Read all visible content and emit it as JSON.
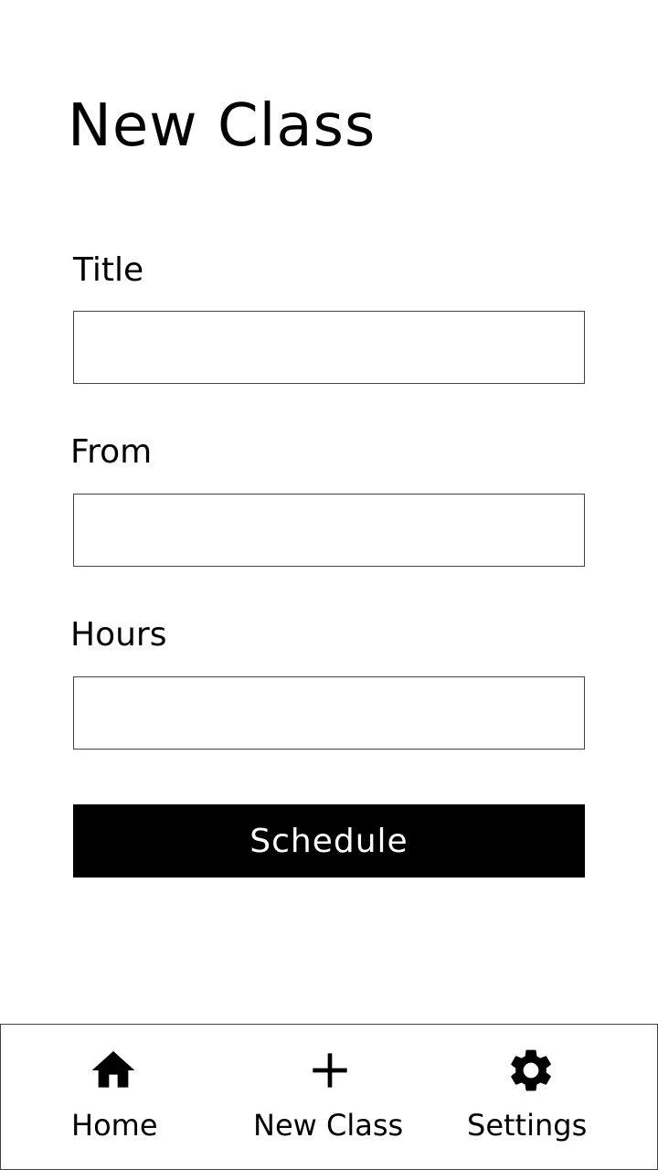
{
  "header": {
    "title": "New Class"
  },
  "form": {
    "title_label": "Title",
    "title_value": "",
    "from_label": "From",
    "from_value": "",
    "hours_label": "Hours",
    "hours_value": "",
    "submit_label": "Schedule"
  },
  "bottom_nav": {
    "items": [
      {
        "label": "Home",
        "icon": "home-icon"
      },
      {
        "label": "New Class",
        "icon": "plus-icon"
      },
      {
        "label": "Settings",
        "icon": "gear-icon"
      }
    ]
  },
  "colors": {
    "background": "#ffffff",
    "text": "#000000",
    "button_bg": "#000000",
    "button_text": "#ffffff",
    "border": "#444444"
  }
}
